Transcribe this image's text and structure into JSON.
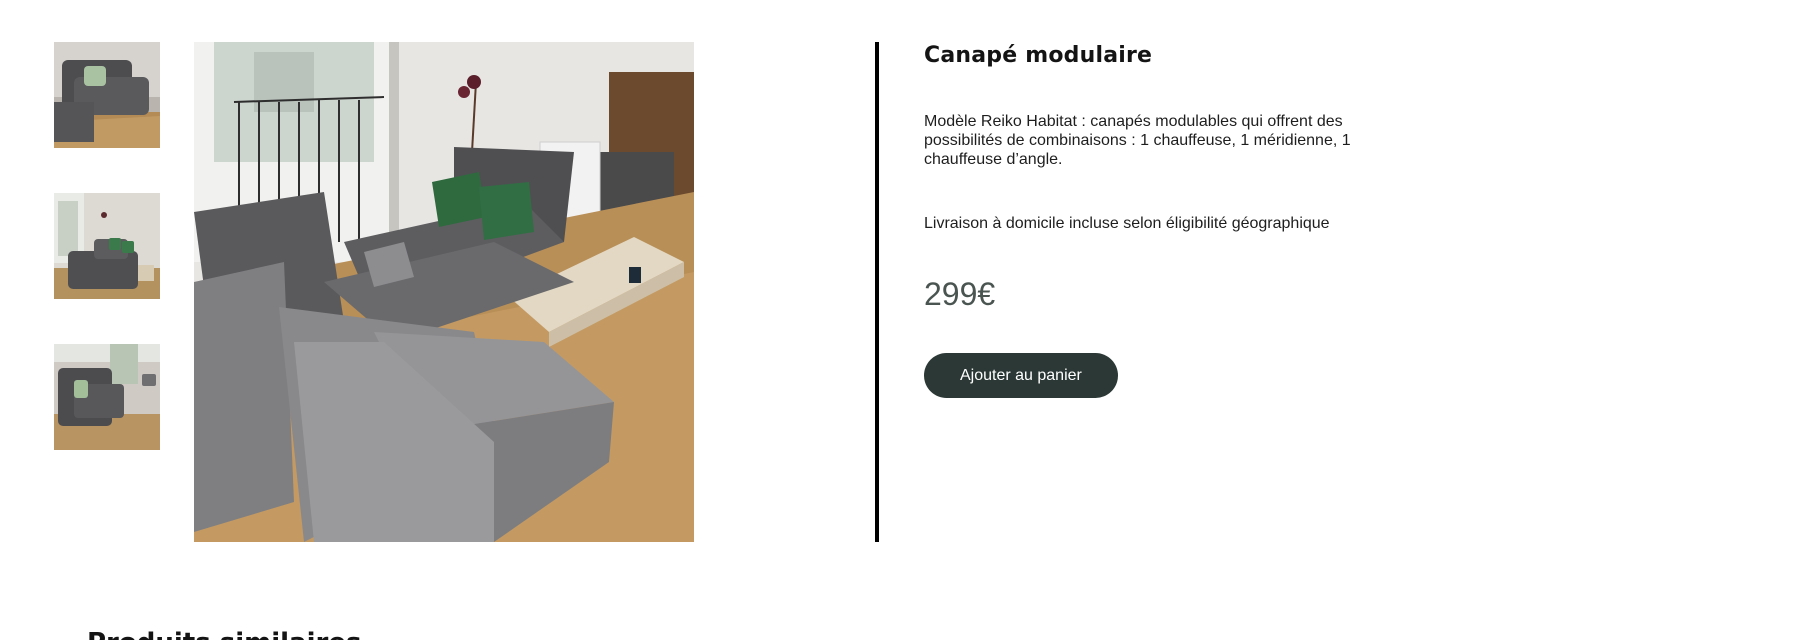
{
  "product": {
    "title": "Canapé modulaire",
    "description": "Modèle Reiko Habitat : canapés modulables qui offrent des possibilités de combinaisons : 1 chauffeuse, 1 méridienne, 1 chauffeuse d’angle.",
    "shipping": "Livraison à domicile incluse selon éligibilité géographique",
    "price": "299€",
    "add_to_cart_label": "Ajouter au panier"
  },
  "gallery": {
    "thumbnail_count": 3,
    "selected_thumbnail": 2
  },
  "sections": {
    "similar_products": "Produits similaires"
  },
  "colors": {
    "button_bg": "#2b3835",
    "price_text": "#4a5552",
    "divider": "#000000"
  }
}
